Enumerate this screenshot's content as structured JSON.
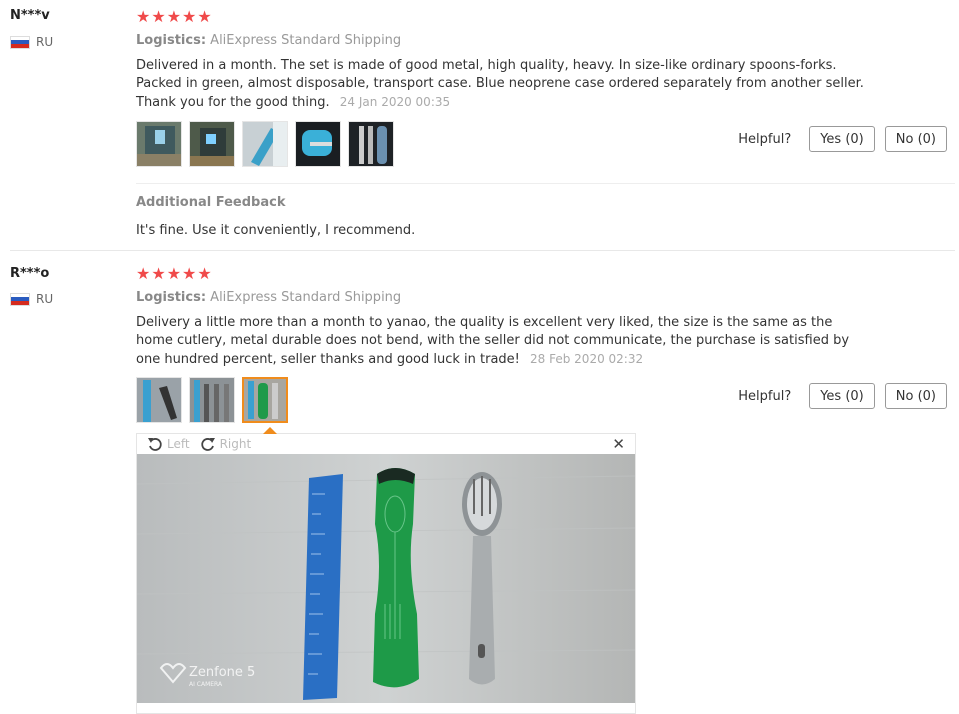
{
  "reviews": [
    {
      "user": "N***v",
      "country": "RU",
      "stars": "★★★★★",
      "logistics_label": "Logistics:",
      "logistics_value": "AliExpress Standard Shipping",
      "text": "Delivered in a month. The set is made of good metal, high quality, heavy. In size-like ordinary spoons-forks. Packed in green, almost disposable, transport case. Blue neoprene case ordered separately from another seller. Thank you for the good thing.",
      "date": "24 Jan 2020 00:35",
      "helpful_label": "Helpful?",
      "yes_label": "Yes (0)",
      "no_label": "No (0)",
      "additional_title": "Additional Feedback",
      "additional_text": "It's fine. Use it conveniently, I recommend."
    },
    {
      "user": "R***o",
      "country": "RU",
      "stars": "★★★★★",
      "logistics_label": "Logistics:",
      "logistics_value": "AliExpress Standard Shipping",
      "text": "Delivery a little more than a month to yanao, the quality is excellent very liked, the size is the same as the home cutlery, metal durable does not bend, with the seller did not communicate, the purchase is satisfied by one hundred percent, seller thanks and good luck in trade!",
      "date": "28 Feb 2020 02:32",
      "helpful_label": "Helpful?",
      "yes_label": "Yes (0)",
      "no_label": "No (0)"
    }
  ],
  "viewer": {
    "left_label": "Left",
    "right_label": "Right",
    "close_icon": "close-icon"
  },
  "colors": {
    "star": "#f04a4a",
    "active_thumb_border": "#f08c1c"
  }
}
